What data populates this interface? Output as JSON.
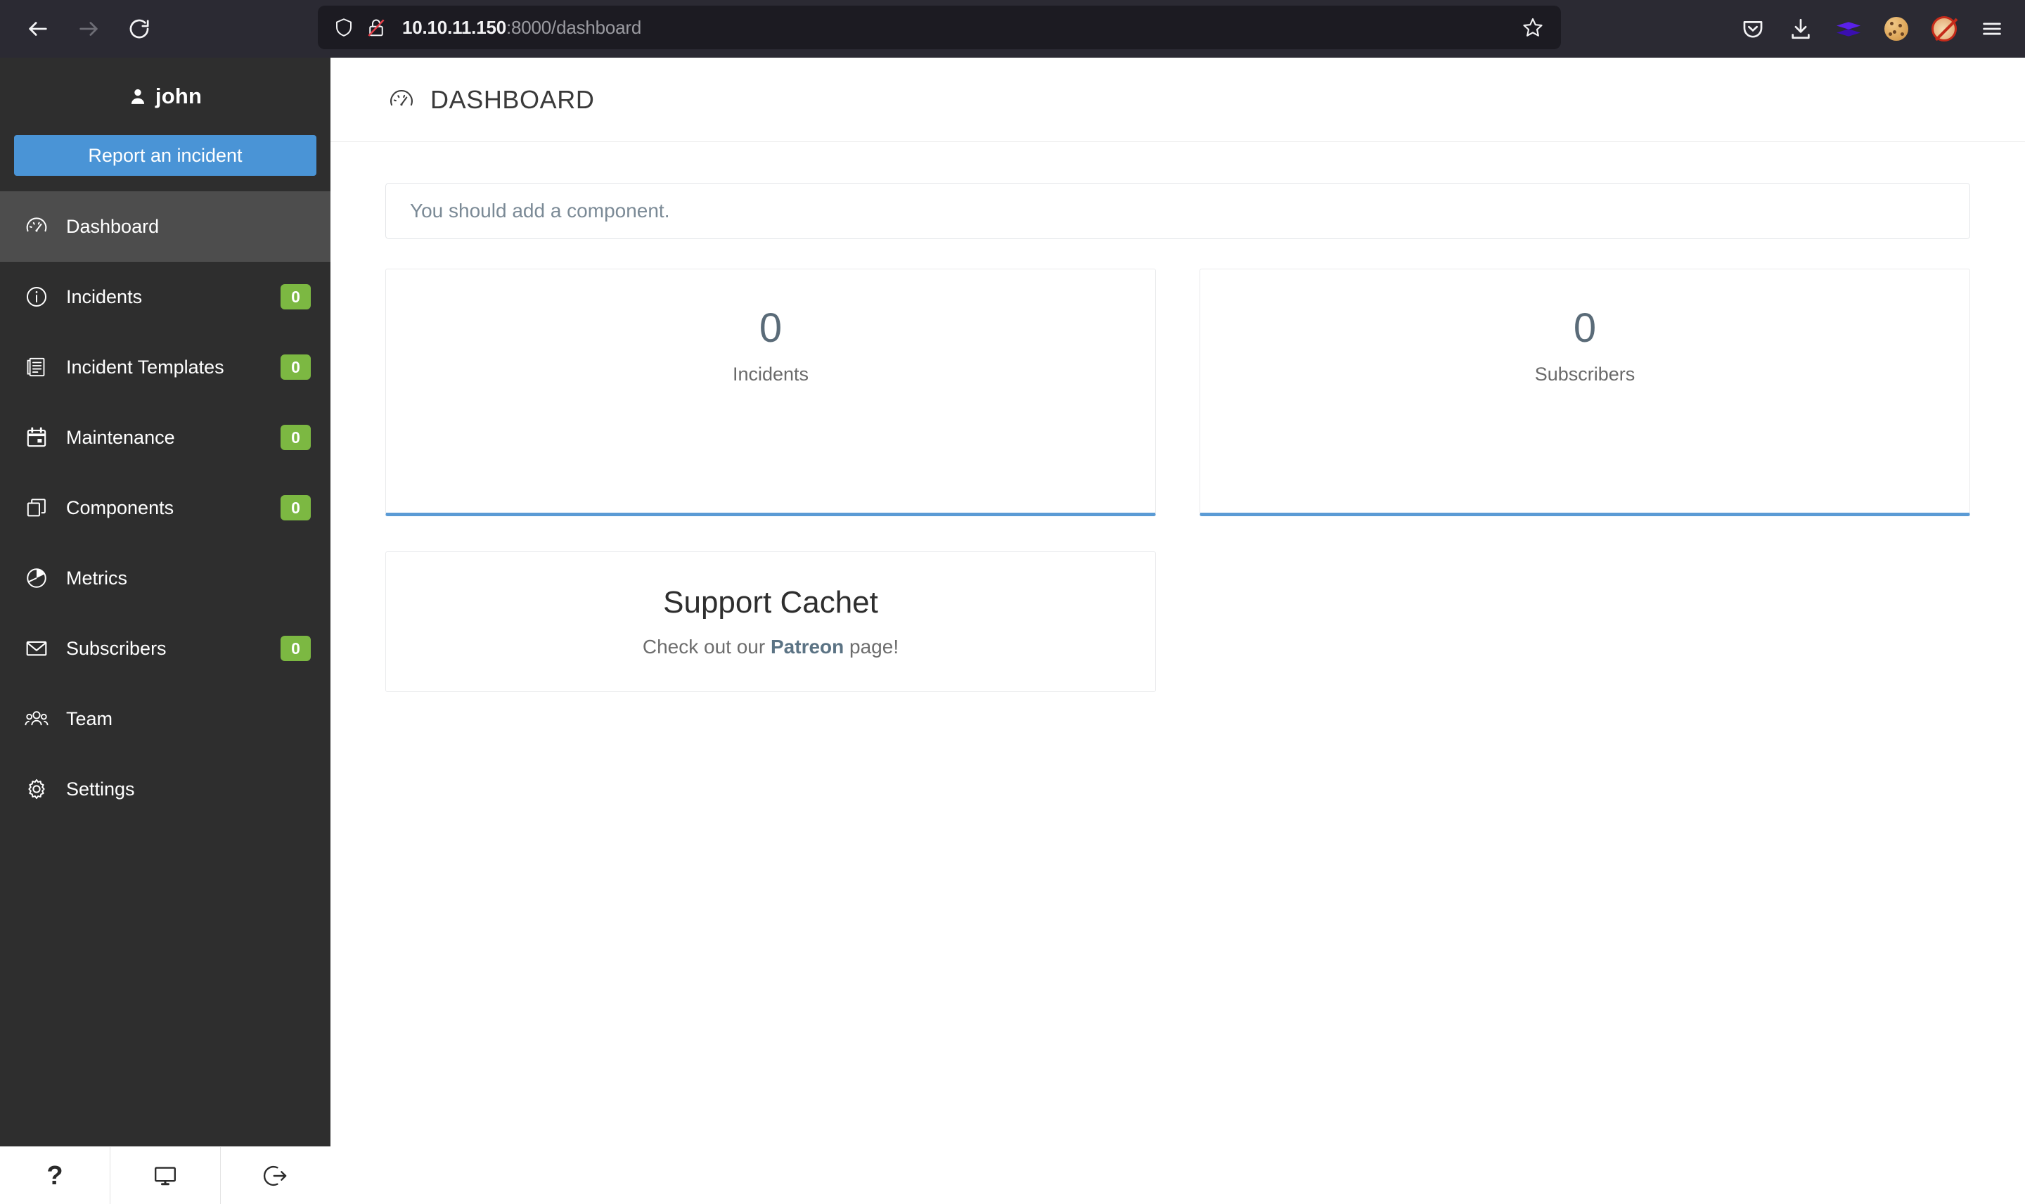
{
  "browser": {
    "back_label": "Back",
    "forward_label": "Forward",
    "reload_label": "Reload",
    "url_host": "10.10.11.150",
    "url_rest": ":8000/dashboard",
    "shield_icon": "shield-icon",
    "insecure_icon": "lock-crossed-icon",
    "bookmark_icon": "star-icon",
    "extensions": [
      {
        "name": "pocket-icon",
        "label": "Save to Pocket"
      },
      {
        "name": "download-icon",
        "label": "Downloads"
      },
      {
        "name": "layers-extension-icon",
        "label": "Extension"
      },
      {
        "name": "cookie-extension-icon",
        "label": "Cookie Editor"
      },
      {
        "name": "foxyproxy-disabled-icon",
        "label": "FoxyProxy"
      },
      {
        "name": "menu-icon",
        "label": "Open application menu"
      }
    ]
  },
  "sidebar": {
    "user": {
      "name": "john",
      "icon": "user-icon"
    },
    "report_button": "Report an incident",
    "items": [
      {
        "label": "Dashboard",
        "icon": "speedometer-icon",
        "badge": null,
        "active": true
      },
      {
        "label": "Incidents",
        "icon": "info-circle-icon",
        "badge": "0",
        "active": false
      },
      {
        "label": "Incident Templates",
        "icon": "list-document-icon",
        "badge": "0",
        "active": false
      },
      {
        "label": "Maintenance",
        "icon": "calendar-icon",
        "badge": "0",
        "active": false
      },
      {
        "label": "Components",
        "icon": "copy-layers-icon",
        "badge": "0",
        "active": false
      },
      {
        "label": "Metrics",
        "icon": "pie-chart-icon",
        "badge": null,
        "active": false
      },
      {
        "label": "Subscribers",
        "icon": "envelope-icon",
        "badge": "0",
        "active": false
      },
      {
        "label": "Team",
        "icon": "people-icon",
        "badge": null,
        "active": false
      },
      {
        "label": "Settings",
        "icon": "gear-icon",
        "badge": null,
        "active": false
      }
    ],
    "footer": [
      {
        "name": "help-icon",
        "label": "?"
      },
      {
        "name": "monitor-icon",
        "label": "Status page"
      },
      {
        "name": "sign-out-icon",
        "label": "Sign out"
      }
    ]
  },
  "page": {
    "title": "DASHBOARD",
    "title_icon": "speedometer-icon",
    "alert": "You should add a component.",
    "stats": [
      {
        "value": "0",
        "label": "Incidents"
      },
      {
        "value": "0",
        "label": "Subscribers"
      }
    ],
    "support": {
      "title": "Support Cachet",
      "prefix": "Check out our ",
      "link": "Patreon",
      "suffix": " page!"
    }
  },
  "colors": {
    "accent_blue": "#4a94d6",
    "badge_green": "#7cb842",
    "card_accent": "#5b9bd5",
    "sidebar_bg": "#2e2e2e",
    "sidebar_active": "#4d4d4d",
    "chrome_bg": "#2b2a33",
    "urlbar_bg": "#1c1b22"
  }
}
